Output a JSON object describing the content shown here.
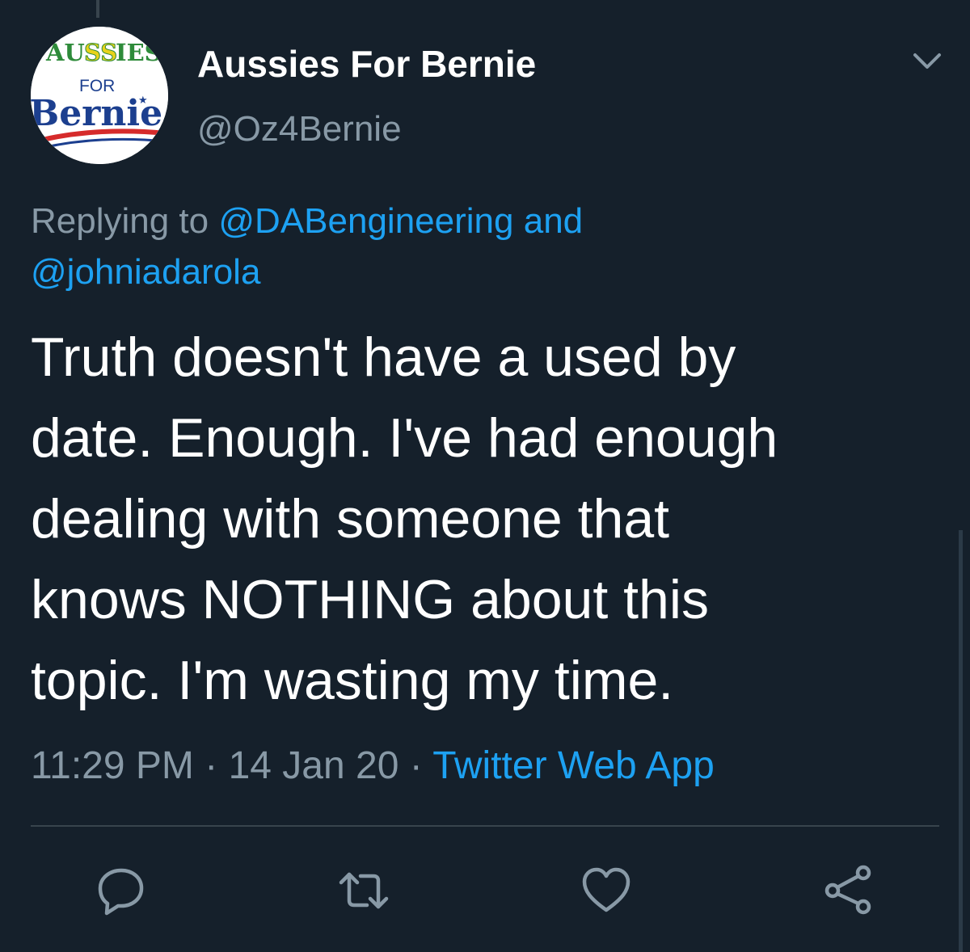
{
  "tweet": {
    "author": {
      "display_name": "Aussies For Bernie",
      "handle": "@Oz4Bernie",
      "avatar_logo": {
        "line1": "AUSSIES",
        "line2": "FOR",
        "line3": "Bernie",
        "colors": {
          "green": "#2e8b3a",
          "yellow": "#e8d21a",
          "blue": "#1c3f8f",
          "red": "#d62b2b"
        }
      }
    },
    "reply_context": {
      "prefix": "Replying to",
      "mention_1": "@DABengineering",
      "connector": "and",
      "mention_2": "@johniadarola"
    },
    "text_lines": [
      "Truth doesn't have a used by",
      "date. Enough. I've had enough",
      "dealing with someone that",
      "knows NOTHING about this",
      "topic. I'm wasting my time."
    ],
    "timestamp": "11:29 PM",
    "separator": "·",
    "date": "14 Jan 20",
    "source": "Twitter Web App"
  },
  "actions": [
    {
      "name": "reply",
      "icon": "reply-icon"
    },
    {
      "name": "retweet",
      "icon": "retweet-icon"
    },
    {
      "name": "like",
      "icon": "heart-icon"
    },
    {
      "name": "share",
      "icon": "share-icon"
    }
  ],
  "colors": {
    "background": "#15202b",
    "text": "#ffffff",
    "muted": "#8899a6",
    "link": "#1da1f2",
    "divider": "#38444d"
  }
}
